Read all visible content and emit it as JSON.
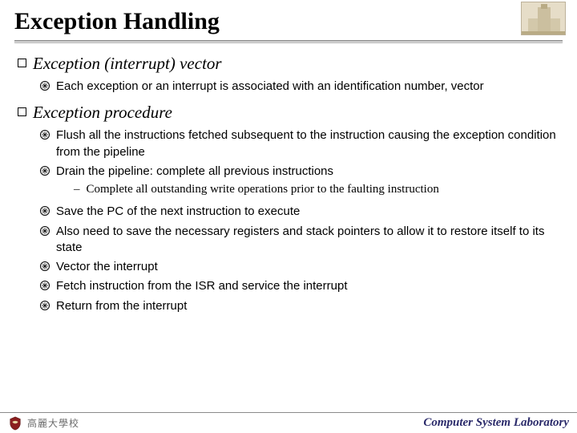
{
  "title": "Exception Handling",
  "sections": [
    {
      "heading": "Exception (interrupt) vector",
      "items": [
        {
          "text": "Each exception or an interrupt is associated with an identification number, vector"
        }
      ]
    },
    {
      "heading": "Exception procedure",
      "items": [
        {
          "text": "Flush all the instructions fetched subsequent to the instruction causing the exception condition from the pipeline"
        },
        {
          "text": "Drain the pipeline: complete all previous instructions",
          "sub": [
            "Complete all outstanding write operations prior to the faulting instruction"
          ]
        },
        {
          "text": "Save the PC of the next instruction to execute"
        },
        {
          "text": "Also need to save the necessary registers and stack pointers to allow it to restore itself to its state"
        },
        {
          "text": "Vector the interrupt"
        },
        {
          "text": "Fetch instruction from the ISR and service the interrupt"
        },
        {
          "text": "Return from the interrupt"
        }
      ]
    }
  ],
  "footer": {
    "university": "高麗大學校",
    "lab": "Computer System Laboratory"
  }
}
